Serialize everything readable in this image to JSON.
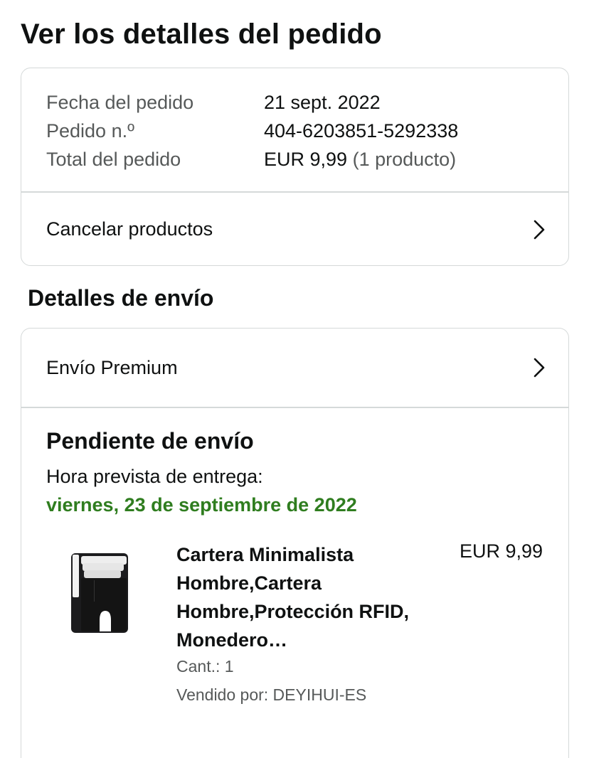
{
  "page": {
    "title": "Ver los detalles del pedido"
  },
  "summary": {
    "rows": [
      {
        "label": "Fecha del pedido",
        "value": "21 sept. 2022"
      },
      {
        "label": "Pedido n.º",
        "value": "404-6203851-5292338"
      },
      {
        "label": "Total del pedido",
        "value": "EUR 9,99",
        "extra": "(1 producto)"
      }
    ],
    "cancel_label": "Cancelar productos"
  },
  "shipping": {
    "section_title": "Detalles de envío",
    "method_label": "Envío Premium",
    "status_title": "Pendiente de envío",
    "delivery_label": "Hora prevista de entrega:",
    "delivery_date": "viernes, 23 de septiembre de 2022",
    "delivery_date_color": "#2f7d1f",
    "product": {
      "title": "Cartera Minimalista Hombre,Cartera Hombre,Protección RFID, Monedero…",
      "price": "EUR 9,99",
      "quantity": "Cant.: 1",
      "seller": "Vendido por: DEYIHUI-ES",
      "image_icon": "wallet-image"
    }
  },
  "colors": {
    "border": "#d5d9d9",
    "secondary_text": "#565959",
    "primary_text": "#0f1111"
  }
}
